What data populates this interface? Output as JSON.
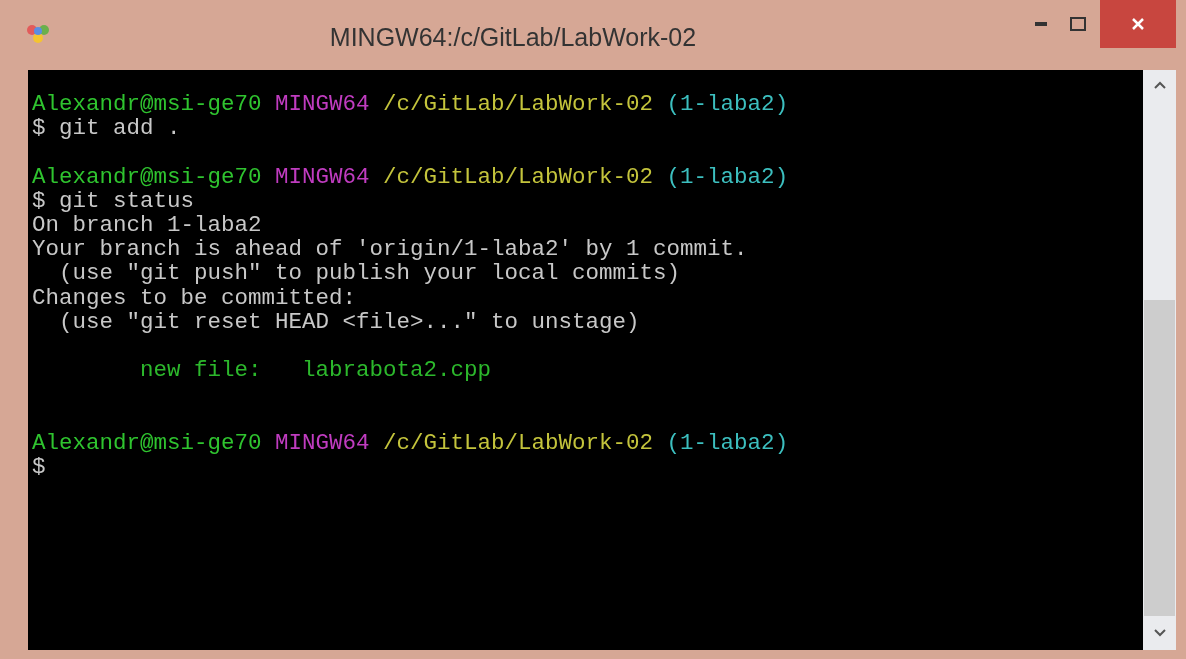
{
  "window": {
    "title": "MINGW64:/c/GitLab/LabWork-02"
  },
  "terminal": {
    "lines": [
      {
        "kind": "text",
        "segments": [
          {
            "kind": "user",
            "text": "Alexandr@msi-ge70"
          },
          {
            "kind": "host",
            "text": "MINGW64"
          },
          {
            "kind": "path",
            "text": "/c/GitLab/LabWork-02"
          },
          {
            "kind": "branch",
            "text": "(1-laba2)"
          }
        ]
      },
      {
        "kind": "text",
        "segments": [
          {
            "kind": "plain",
            "text": "$ git add ."
          }
        ]
      },
      {
        "kind": "blank"
      },
      {
        "kind": "text",
        "segments": [
          {
            "kind": "user",
            "text": "Alexandr@msi-ge70"
          },
          {
            "kind": "host",
            "text": "MINGW64"
          },
          {
            "kind": "path",
            "text": "/c/GitLab/LabWork-02"
          },
          {
            "kind": "branch",
            "text": "(1-laba2)"
          }
        ]
      },
      {
        "kind": "text",
        "segments": [
          {
            "kind": "plain",
            "text": "$ git status"
          }
        ]
      },
      {
        "kind": "text",
        "segments": [
          {
            "kind": "plain",
            "text": "On branch 1-laba2"
          }
        ]
      },
      {
        "kind": "text",
        "segments": [
          {
            "kind": "plain",
            "text": "Your branch is ahead of 'origin/1-laba2' by 1 commit."
          }
        ]
      },
      {
        "kind": "text",
        "segments": [
          {
            "kind": "plain",
            "text": "  (use \"git push\" to publish your local commits)"
          }
        ]
      },
      {
        "kind": "text",
        "segments": [
          {
            "kind": "plain",
            "text": "Changes to be committed:"
          }
        ]
      },
      {
        "kind": "text",
        "segments": [
          {
            "kind": "plain",
            "text": "  (use \"git reset HEAD <file>...\" to unstage)"
          }
        ]
      },
      {
        "kind": "blank"
      },
      {
        "kind": "text",
        "segments": [
          {
            "kind": "staged",
            "text": "        new file:   labrabota2.cpp"
          }
        ]
      },
      {
        "kind": "blank"
      },
      {
        "kind": "blank"
      },
      {
        "kind": "text",
        "segments": [
          {
            "kind": "user",
            "text": "Alexandr@msi-ge70"
          },
          {
            "kind": "host",
            "text": "MINGW64"
          },
          {
            "kind": "path",
            "text": "/c/GitLab/LabWork-02"
          },
          {
            "kind": "branch",
            "text": "(1-laba2)"
          }
        ]
      },
      {
        "kind": "text",
        "segments": [
          {
            "kind": "plain",
            "text": "$"
          }
        ]
      }
    ]
  }
}
